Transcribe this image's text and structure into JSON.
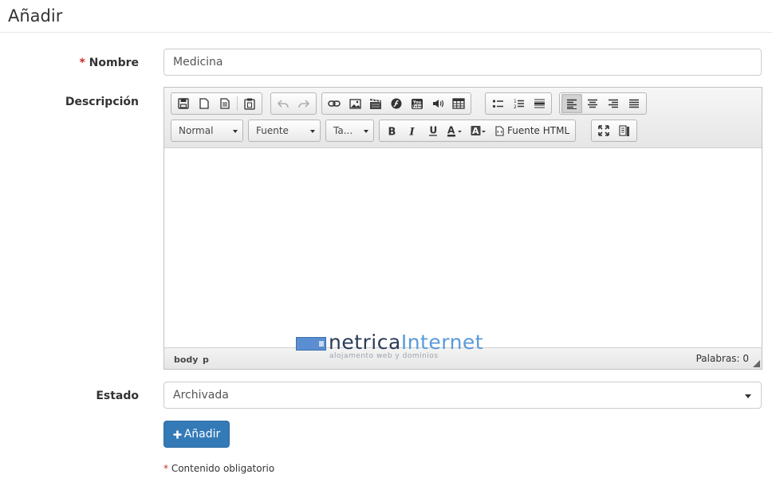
{
  "page": {
    "title": "Añadir"
  },
  "form": {
    "required_mark": "*",
    "nombre": {
      "label": "Nombre",
      "value": "Medicina"
    },
    "descripcion": {
      "label": "Descripción"
    },
    "estado": {
      "label": "Estado",
      "value": "Archivada"
    },
    "submit_label": "Añadir",
    "required_note": "Contenido obligatorio"
  },
  "editor": {
    "toolbar": {
      "format_combo": "Normal",
      "font_combo": "Fuente",
      "size_combo": "Ta...",
      "source_label": "Fuente HTML",
      "icons": [
        "save-icon",
        "new-page-icon",
        "preview-icon",
        "paste-icon",
        "undo-icon",
        "redo-icon",
        "link-icon",
        "image-icon",
        "video-icon",
        "flash-icon",
        "youtube-icon",
        "audio-icon",
        "table-icon",
        "bulleted-list-icon",
        "numbered-list-icon",
        "horizontal-rule-icon",
        "align-left-icon",
        "align-center-icon",
        "align-right-icon",
        "justify-icon",
        "bold-icon",
        "italic-icon",
        "underline-icon",
        "text-color-icon",
        "background-color-icon",
        "maximize-icon",
        "show-blocks-icon"
      ]
    },
    "footer": {
      "path": [
        "body",
        "p"
      ],
      "word_count": "Palabras: 0"
    },
    "watermark": {
      "part1": "netrica",
      "part2": "Internet",
      "subtitle": "alojamento web y dominios"
    }
  },
  "colors": {
    "primary": "#337ab7",
    "required": "#c9302c"
  }
}
